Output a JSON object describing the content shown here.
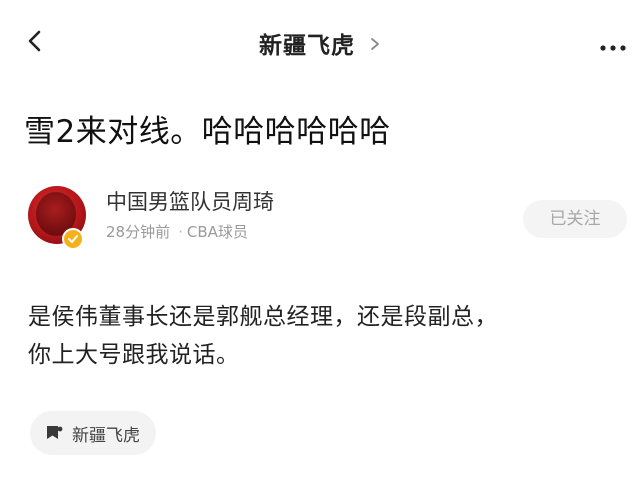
{
  "nav": {
    "back_icon": "chevron-left-icon",
    "title": "新疆飞虎",
    "title_chevron_icon": "chevron-right-icon",
    "more_icon": "more-horizontal-icon"
  },
  "post": {
    "title": "雪2来对线。哈哈哈哈哈哈",
    "body_lines": [
      "是侯伟董事长还是郭舰总经理，还是段副总，",
      "你上大号跟我说话。"
    ]
  },
  "author": {
    "name": "中国男篮队员周琦",
    "time": "28分钟前",
    "separator": "·",
    "title": "CBA球员",
    "avatar_icon": "avatar",
    "badge_icon": "verified-badge-icon",
    "badge_color": "#f3b21c"
  },
  "follow_button": {
    "label": "已关注"
  },
  "topic": {
    "icon": "topic-bookmark-icon",
    "label": "新疆飞虎"
  },
  "colors": {
    "text_primary": "#111111",
    "text_secondary": "#9a9a9a",
    "pill_background": "#f3f3f3",
    "follow_text": "#a8a8a8"
  }
}
